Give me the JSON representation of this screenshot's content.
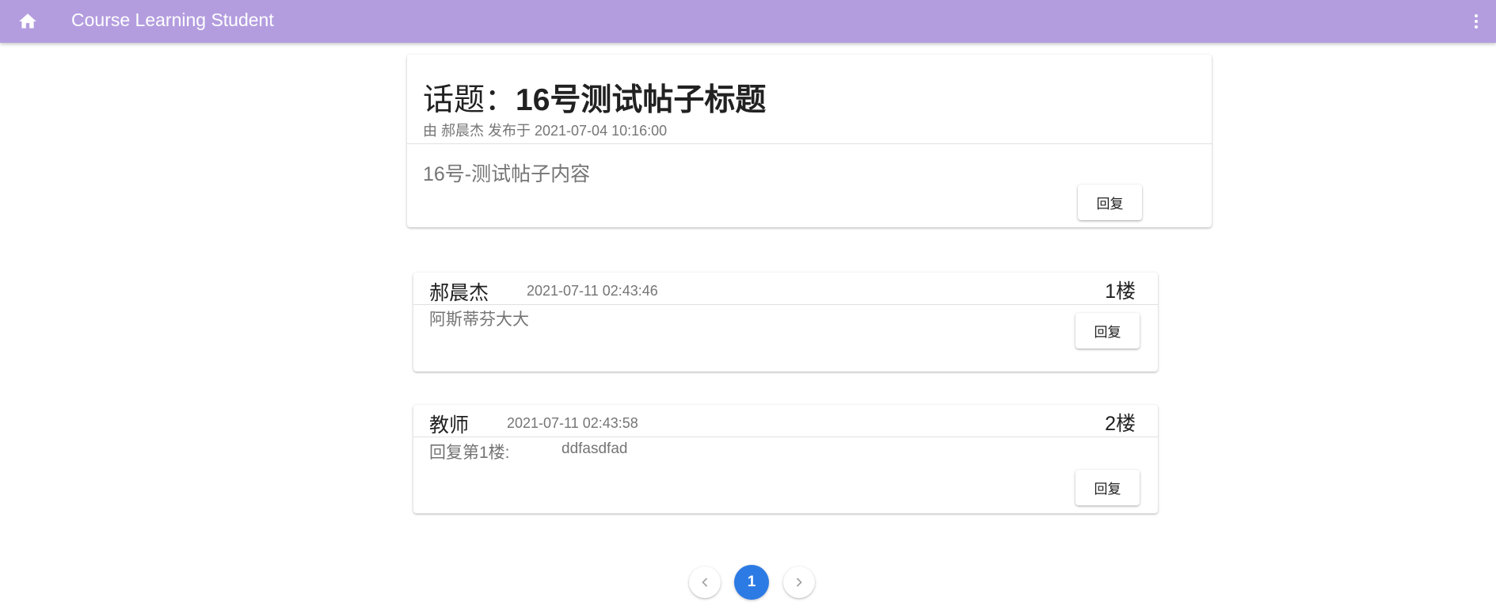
{
  "appbar": {
    "title": "Course Learning Student",
    "home_icon": "home-icon",
    "menu_icon": "more-vert-icon",
    "color": "#b39ddf"
  },
  "topic": {
    "prefix": "话题：",
    "title": "16号测试帖子标题",
    "meta": "由 郝晨杰 发布于 2021-07-04 10:16:00",
    "content": "16号-测试帖子内容",
    "reply_label": "回复"
  },
  "replies": [
    {
      "author": "郝晨杰",
      "time": "2021-07-11 02:43:46",
      "floor": "1楼",
      "content": "阿斯蒂芬大大",
      "reply_label": "回复"
    },
    {
      "author": "教师",
      "time": "2021-07-11 02:43:58",
      "floor": "2楼",
      "quote_label": "回复第1楼:",
      "content": "ddfasdfad",
      "reply_label": "回复"
    }
  ],
  "pagination": {
    "current_page": "1",
    "prev_icon": "chevron-left-icon",
    "next_icon": "chevron-right-icon",
    "active_color": "#2c7be5"
  }
}
